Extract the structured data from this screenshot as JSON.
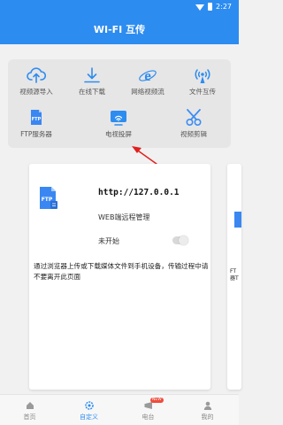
{
  "status_bar": {
    "time": "2:27",
    "icons": [
      "wifi-icon",
      "battery-icon"
    ]
  },
  "app_bar": {
    "title": "WI-FI 互传"
  },
  "tools": [
    {
      "icon": "cloud-upload-icon",
      "label": "视频源导入"
    },
    {
      "icon": "download-icon",
      "label": "在线下载"
    },
    {
      "icon": "browser-icon",
      "label": "网络视频流"
    },
    {
      "icon": "file-transfer-icon",
      "label": "文件互传"
    },
    {
      "icon": "ftp-file-icon",
      "label": "FTP服务器"
    },
    {
      "icon": "tv-cast-icon",
      "label": "电视投屏"
    },
    {
      "icon": "scissors-icon",
      "label": "视频剪辑"
    }
  ],
  "ftp_card": {
    "url": "http://127.0.0.1",
    "subtitle": "WEB端远程管理",
    "status": "未开始",
    "toggle_on": false,
    "description": "通过浏览器上传或下载媒体文件到手机设备，传输过程中请不要离开此页面"
  },
  "next_card_peek": {
    "text_line1": "FT",
    "text_line2": "器T"
  },
  "bottom_nav": [
    {
      "icon": "home-icon",
      "label": "首页",
      "active": false
    },
    {
      "icon": "custom-icon",
      "label": "自定义",
      "active": true
    },
    {
      "icon": "radio-station-icon",
      "label": "电台",
      "active": false,
      "badge": "NEW"
    },
    {
      "icon": "profile-icon",
      "label": "我的",
      "active": false
    }
  ],
  "colors": {
    "primary": "#2d8cf0",
    "ftp_icon": "#3a87f2",
    "scissors": "#3c8df2",
    "arrow": "#e02020",
    "badge": "#f04b3c"
  }
}
